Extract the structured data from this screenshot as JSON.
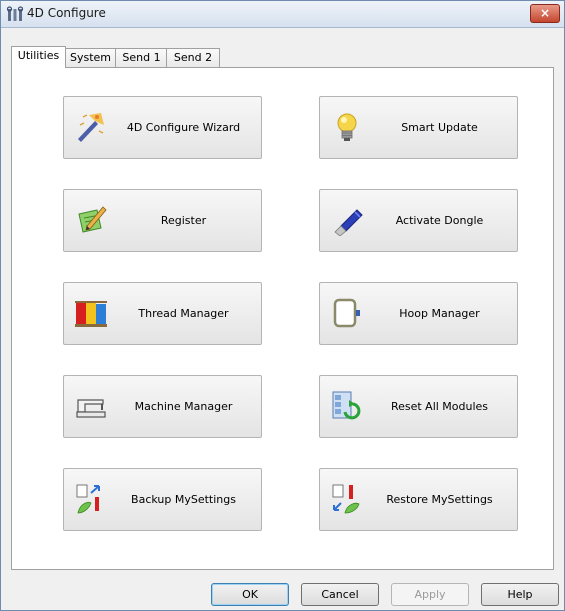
{
  "window": {
    "title": "4D Configure",
    "close_glyph": "×",
    "icon": "app-tools-icon"
  },
  "tabs": [
    {
      "label": "Utilities",
      "active": true
    },
    {
      "label": "System",
      "active": false
    },
    {
      "label": "Send 1",
      "active": false
    },
    {
      "label": "Send 2",
      "active": false
    }
  ],
  "buttons": [
    {
      "label": "4D Configure Wizard",
      "icon": "wizard-icon"
    },
    {
      "label": "Smart Update",
      "icon": "lightbulb-icon"
    },
    {
      "label": "Register",
      "icon": "register-pencil-icon"
    },
    {
      "label": "Activate Dongle",
      "icon": "usb-dongle-icon"
    },
    {
      "label": "Thread Manager",
      "icon": "thread-spools-icon"
    },
    {
      "label": "Hoop Manager",
      "icon": "hoop-icon"
    },
    {
      "label": "Machine Manager",
      "icon": "sewing-machine-icon"
    },
    {
      "label": "Reset All Modules",
      "icon": "reset-modules-icon"
    },
    {
      "label": "Backup MySettings",
      "icon": "backup-settings-icon"
    },
    {
      "label": "Restore MySettings",
      "icon": "restore-settings-icon"
    }
  ],
  "footer": {
    "ok": "OK",
    "cancel": "Cancel",
    "apply": "Apply",
    "help": "Help"
  }
}
